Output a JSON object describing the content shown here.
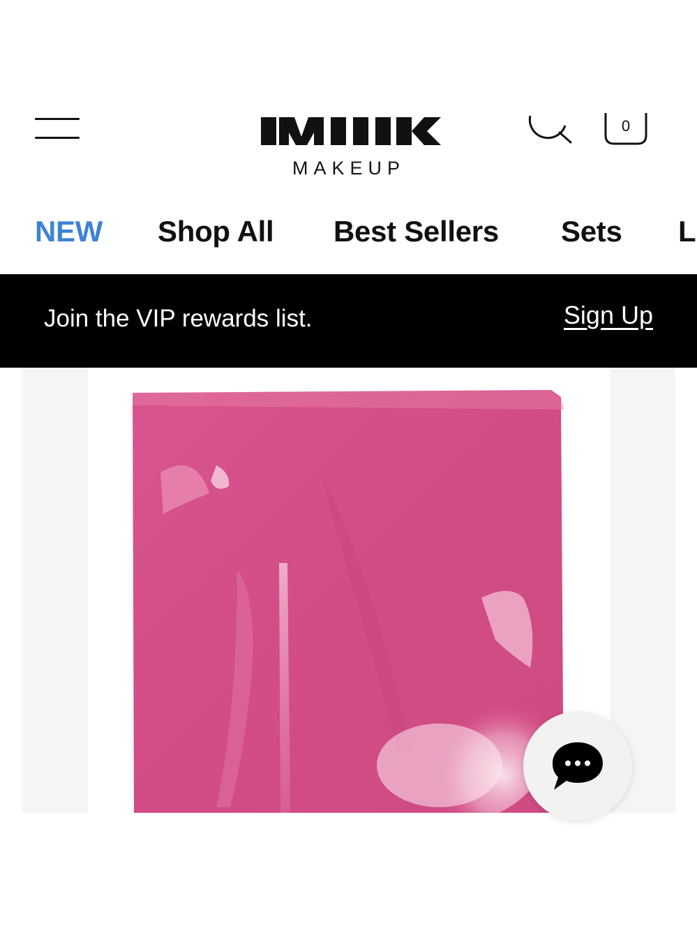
{
  "header": {
    "menu_icon": "hamburger-menu-icon",
    "logo_wordmark": "MILK",
    "logo_sub": "MAKEUP",
    "search_icon": "search-icon",
    "cart_icon": "shopping-bag-icon",
    "cart_count": "0"
  },
  "nav": {
    "items": [
      {
        "label": "NEW"
      },
      {
        "label": "Shop All"
      },
      {
        "label": "Best Sellers"
      },
      {
        "label": "Sets"
      },
      {
        "label": "L"
      }
    ],
    "highlight_color": "#3d82d6"
  },
  "banner": {
    "text": "Join the VIP rewards list.",
    "link": "Sign Up",
    "background": "#000000"
  },
  "product": {
    "swatch_color": "#d64f8a",
    "image_icon": "lipstick-swatch-image"
  },
  "chat": {
    "icon": "chat-bubble-icon"
  }
}
